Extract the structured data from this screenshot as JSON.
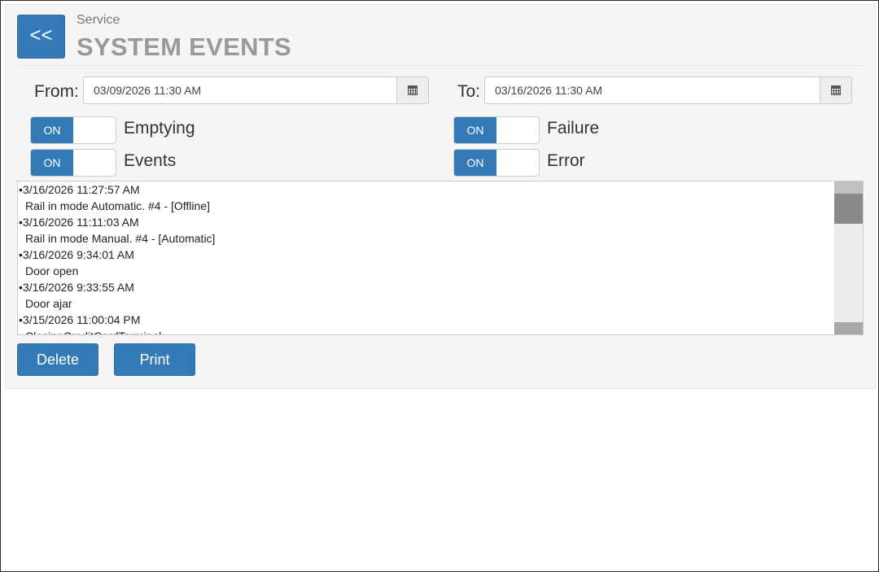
{
  "header": {
    "back_label": "<<",
    "breadcrumb": "Service",
    "title": "SYSTEM EVENTS"
  },
  "filters": {
    "from_label": "From:",
    "from_value": "03/09/2026 11:30 AM",
    "to_label": "To:",
    "to_value": "03/16/2026 11:30 AM",
    "calendar_icon": "calendar-icon"
  },
  "toggles": [
    {
      "state": "ON",
      "label": "Emptying"
    },
    {
      "state": "ON",
      "label": "Failure"
    },
    {
      "state": "ON",
      "label": "Events"
    },
    {
      "state": "ON",
      "label": "Error"
    }
  ],
  "events": [
    {
      "time": "•3/16/2026 11:27:57 AM",
      "message": "Rail in mode Automatic. #4 - [Offline]"
    },
    {
      "time": "•3/16/2026 11:11:03 AM",
      "message": "Rail in mode Manual. #4 - [Automatic]"
    },
    {
      "time": "•3/16/2026 9:34:01 AM",
      "message": "Door open"
    },
    {
      "time": "•3/16/2026 9:33:55 AM",
      "message": "Door ajar"
    },
    {
      "time": "•3/15/2026 11:00:04 PM",
      "message": "ClosingCreditCardTerminal"
    }
  ],
  "actions": {
    "delete_label": "Delete",
    "print_label": "Print"
  },
  "colors": {
    "primary": "#337ab7",
    "title_gray": "#999999",
    "panel_bg": "#f5f5f5"
  }
}
